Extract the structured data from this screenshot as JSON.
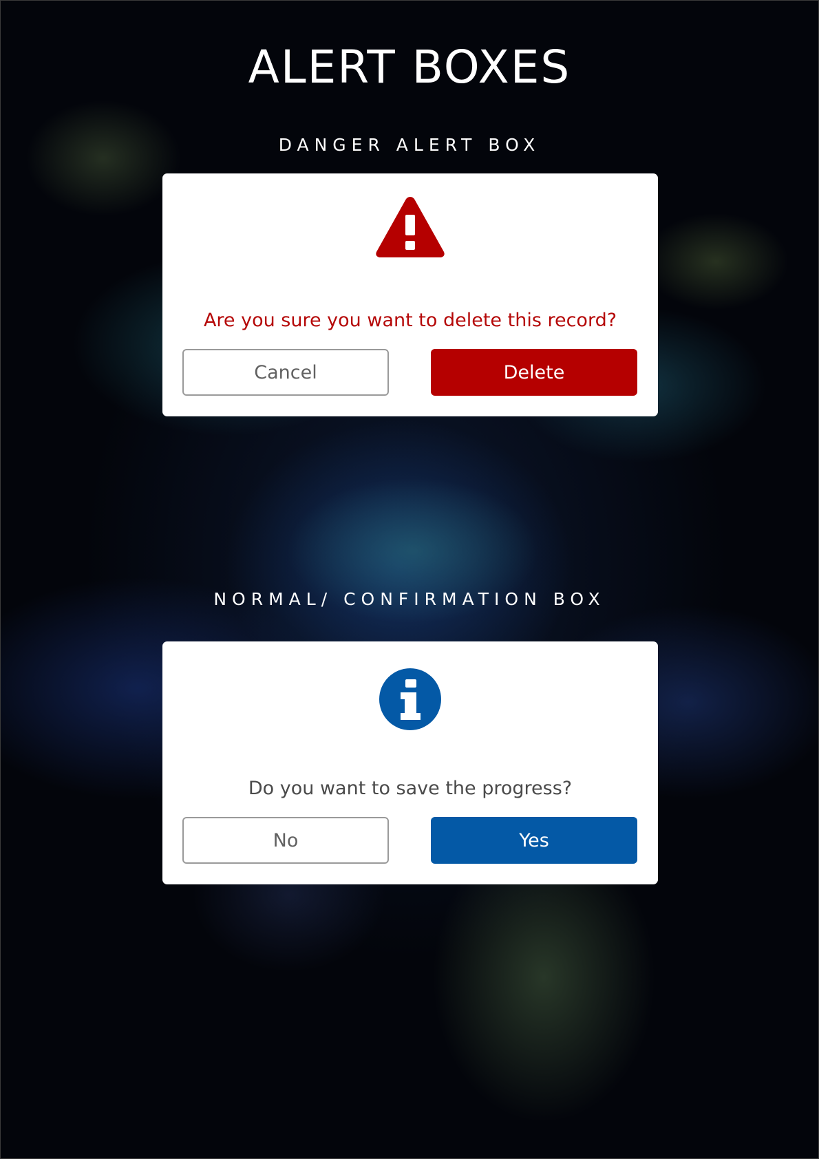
{
  "page": {
    "title": "ALERT BOXES"
  },
  "danger": {
    "section_label": "DANGER ALERT BOX",
    "icon": "warning-triangle-icon",
    "message": "Are you sure you want to delete this record?",
    "cancel_label": "Cancel",
    "confirm_label": "Delete",
    "accent_color": "#b50000"
  },
  "confirmation": {
    "section_label": "NORMAL/ CONFIRMATION BOX",
    "icon": "info-circle-icon",
    "message": "Do you want to save the progress?",
    "cancel_label": "No",
    "confirm_label": "Yes",
    "accent_color": "#0459a6"
  }
}
